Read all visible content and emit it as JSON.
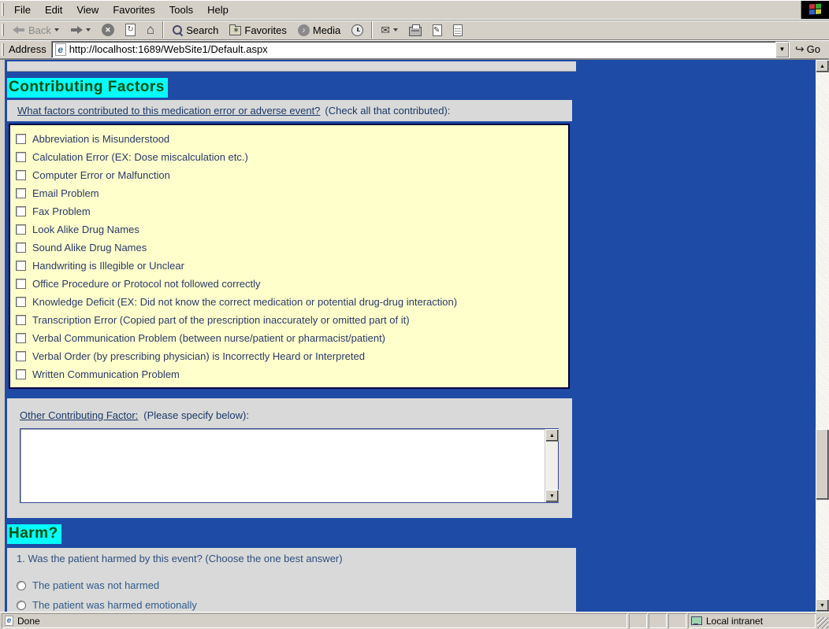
{
  "browser": {
    "menu_items": [
      "File",
      "Edit",
      "View",
      "Favorites",
      "Tools",
      "Help"
    ],
    "toolbar": {
      "back_label": "Back",
      "search_label": "Search",
      "favorites_label": "Favorites",
      "media_label": "Media"
    },
    "address_bar": {
      "label": "Address",
      "url": "http://localhost:1689/WebSite1/Default.aspx",
      "go_label": "Go"
    },
    "status_bar": {
      "status_text": "Done",
      "zone_text": "Local intranet"
    }
  },
  "page": {
    "contributing_factors": {
      "heading": "Contributing Factors",
      "question_link": "What factors contributed to this medication error or adverse event?",
      "question_note": "(Check all that contributed):",
      "factors": [
        "Abbreviation is Misunderstood",
        "Calculation Error (EX: Dose miscalculation etc.)",
        "Computer Error or Malfunction",
        "Email Problem",
        "Fax Problem",
        "Look Alike Drug Names",
        "Sound Alike Drug Names",
        "Handwriting is Illegible or Unclear",
        "Office Procedure or Protocol not followed correctly",
        "Knowledge Deficit (EX: Did not know the correct medication or potential drug-drug interaction)",
        "Transcription Error (Copied part of the prescription inaccurately or omitted part of it)",
        "Verbal Communication Problem (between nurse/patient or pharmacist/patient)",
        "Verbal Order (by prescribing physician) is Incorrectly Heard or Interpreted",
        "Written Communication Problem"
      ]
    },
    "other_factor": {
      "label_link": "Other Contributing Factor:",
      "label_note": "(Please specify below):",
      "textarea_value": ""
    },
    "harm": {
      "heading": "Harm?",
      "question": "1. Was the patient harmed by this event? (Choose the one best answer)",
      "options": [
        "The patient was not harmed",
        "The patient was harmed emotionally"
      ]
    }
  },
  "colors": {
    "page_background": "#1E4BA5",
    "heading_highlight": "#00FFFF",
    "heading_text": "#0A4F0A",
    "checkbox_panel": "#FFFFCC",
    "section_panel": "#D9D9D9",
    "link_navy": "#1C3969",
    "chrome_gray": "#D4D0C8"
  }
}
